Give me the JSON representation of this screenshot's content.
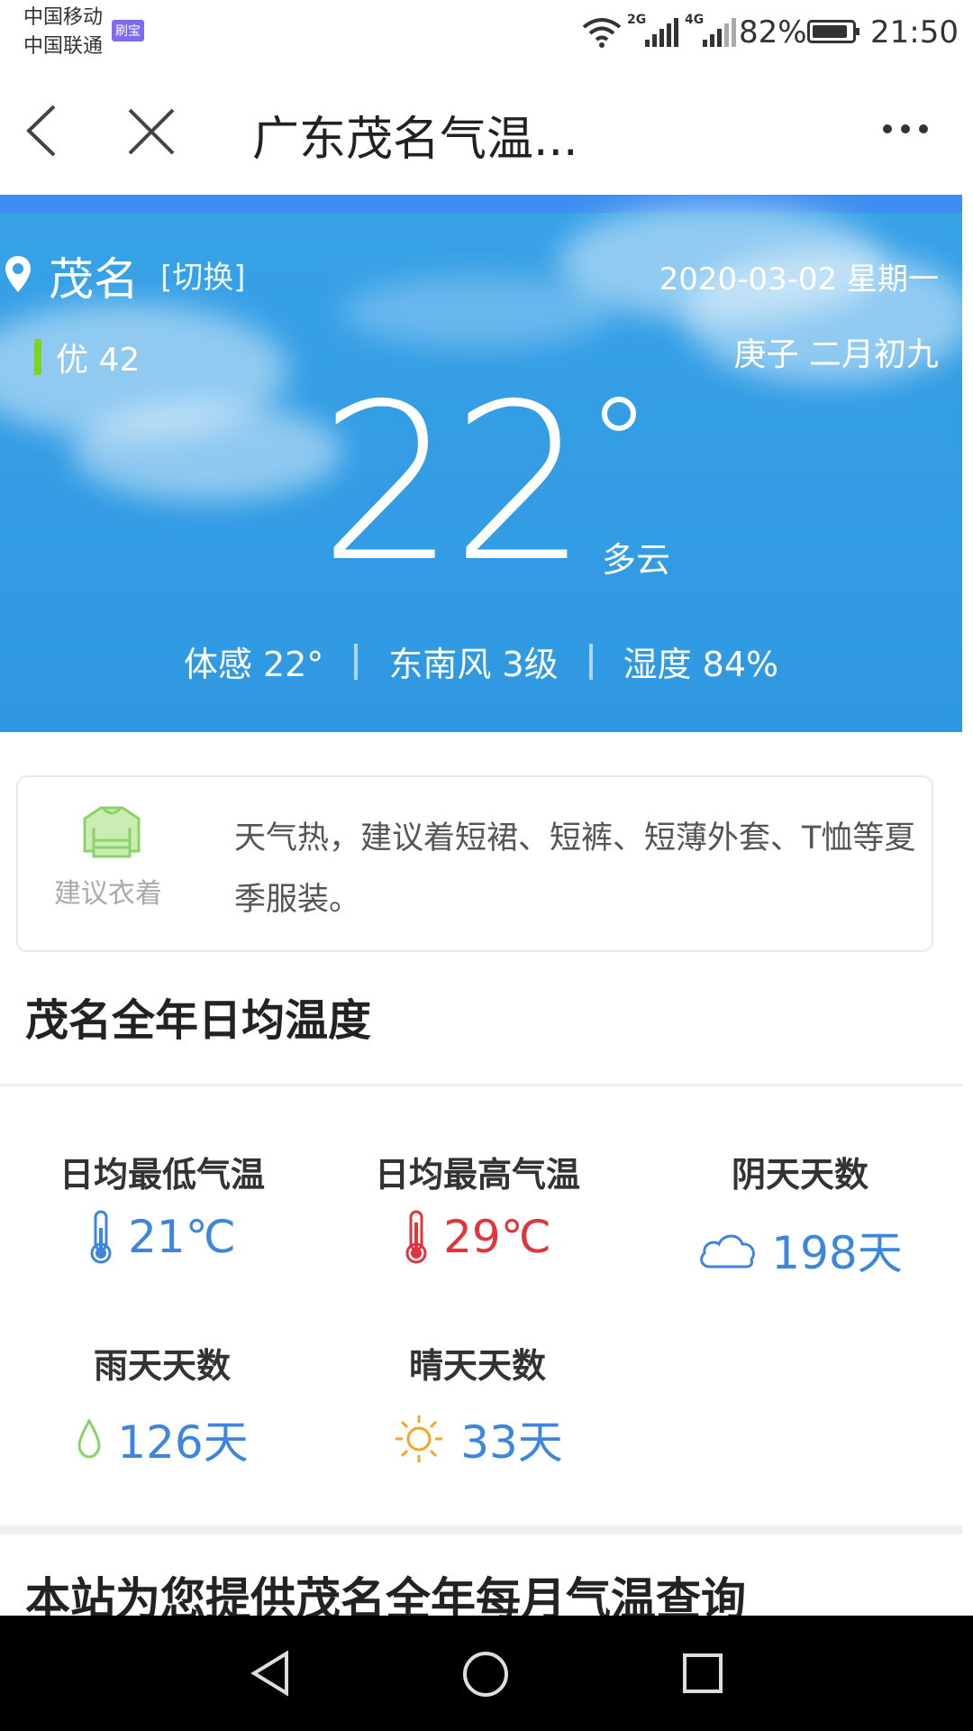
{
  "status_bar": {
    "carrier1": "中国移动",
    "carrier2": "中国联通",
    "badge": "刷宝",
    "net1": "2G",
    "net2": "4G",
    "battery": "82%",
    "time": "21:50"
  },
  "nav": {
    "title": "广东茂名气温..."
  },
  "hero": {
    "city": "茂名",
    "switch_label": "[切换]",
    "date": "2020-03-02 星期一",
    "lunar": "庚子 二月初九",
    "aqi": "优 42",
    "temperature": "22",
    "condition": "多云",
    "feels_like": "体感 22°",
    "wind": "东南风 3级",
    "humidity": "湿度 84%"
  },
  "advice": {
    "label": "建议衣着",
    "text": "天气热，建议着短裙、短裤、短薄外套、T恤等夏季服装。"
  },
  "section": {
    "title": "茂名全年日均温度",
    "stats": [
      {
        "label": "日均最低气温",
        "value": "21℃",
        "icon": "thermometer-cold-icon"
      },
      {
        "label": "日均最高气温",
        "value": "29℃",
        "icon": "thermometer-hot-icon"
      },
      {
        "label": "阴天天数",
        "value": "198天",
        "icon": "cloud-icon"
      },
      {
        "label": "雨天天数",
        "value": "126天",
        "icon": "raindrop-icon"
      },
      {
        "label": "晴天天数",
        "value": "33天",
        "icon": "sun-icon"
      }
    ]
  },
  "next_section": {
    "title": "本站为您提供茂名全年每月气温查询"
  },
  "colors": {
    "hero": "#2f98e2",
    "accent_blue": "#3d86de",
    "accent_red": "#e0353b",
    "aqi_good": "#7ed321"
  }
}
